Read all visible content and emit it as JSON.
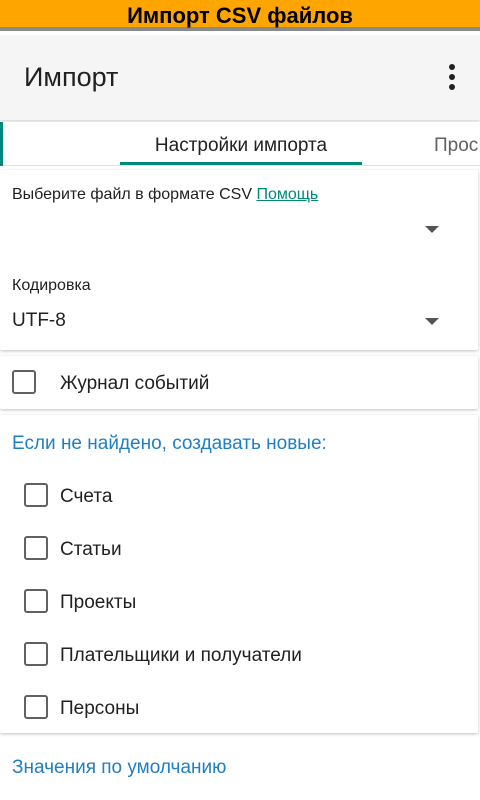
{
  "banner": {
    "text": "Импорт CSV файлов"
  },
  "appbar": {
    "title": "Импорт",
    "menu_icon": "more-vert-icon"
  },
  "tabs": [
    {
      "label": "Настройки импорта",
      "selected": true
    },
    {
      "label": "Прос",
      "selected": false
    }
  ],
  "file_section": {
    "prompt": "Выберите файл в формате CSV",
    "help_link": "Помощь",
    "selected_file": ""
  },
  "encoding": {
    "label": "Кодировка",
    "value": "UTF-8"
  },
  "event_log": {
    "label": "Журнал событий",
    "checked": false
  },
  "create_new": {
    "heading": "Если не найдено, создавать новые:",
    "options": [
      {
        "label": "Счета",
        "checked": false
      },
      {
        "label": "Статьи",
        "checked": false
      },
      {
        "label": "Проекты",
        "checked": false
      },
      {
        "label": "Плательщики и получатели",
        "checked": false
      },
      {
        "label": "Персоны",
        "checked": false
      }
    ]
  },
  "defaults": {
    "label": "Значения по умолчанию"
  },
  "colors": {
    "banner": "#ffa500",
    "accent": "#00897b",
    "link_blue": "#1e7fc4"
  }
}
